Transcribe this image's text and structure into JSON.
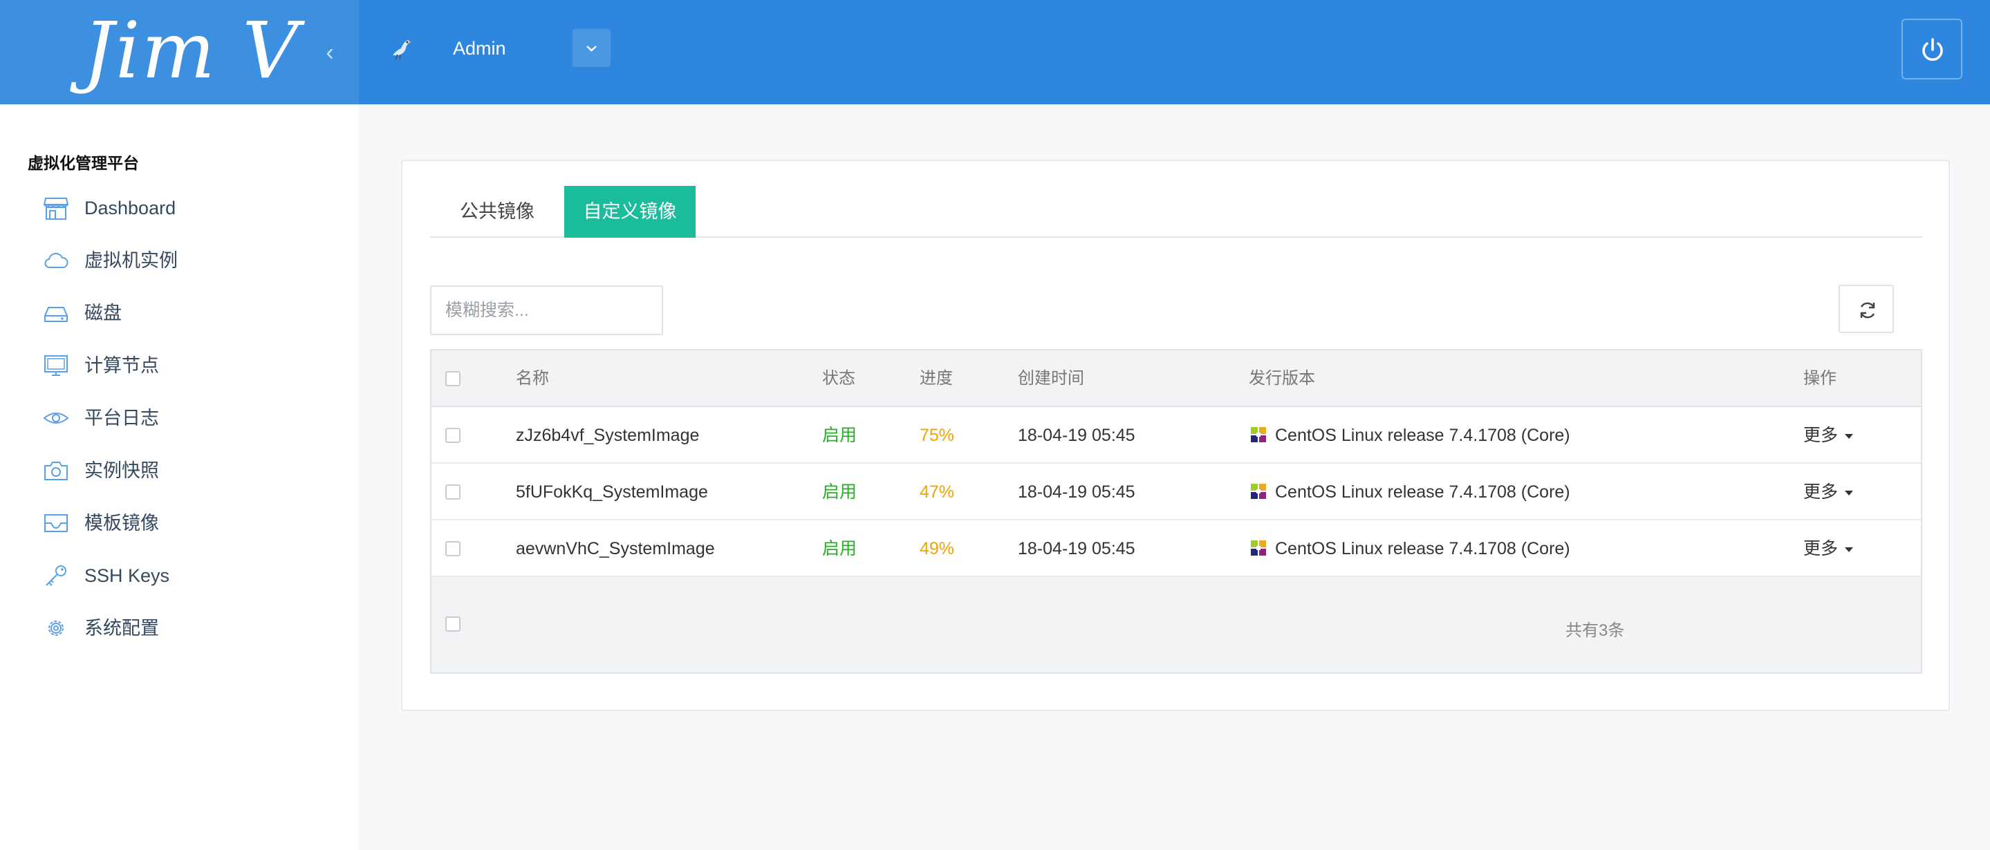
{
  "header": {
    "logo": "Jim V",
    "user_name": "Admin"
  },
  "sidebar": {
    "title": "虚拟化管理平台",
    "items": [
      {
        "label": "Dashboard",
        "icon": "store-icon"
      },
      {
        "label": "虚拟机实例",
        "icon": "cloud-icon"
      },
      {
        "label": "磁盘",
        "icon": "disk-icon"
      },
      {
        "label": "计算节点",
        "icon": "monitor-icon"
      },
      {
        "label": "平台日志",
        "icon": "eye-icon"
      },
      {
        "label": "实例快照",
        "icon": "camera-icon"
      },
      {
        "label": "模板镜像",
        "icon": "inbox-icon"
      },
      {
        "label": "SSH Keys",
        "icon": "key-icon"
      },
      {
        "label": "系统配置",
        "icon": "gear-icon"
      }
    ]
  },
  "tabs": {
    "public": "公共镜像",
    "custom": "自定义镜像",
    "active": "custom"
  },
  "search": {
    "placeholder": "模糊搜索...",
    "value": ""
  },
  "table": {
    "columns": [
      "名称",
      "状态",
      "进度",
      "创建时间",
      "发行版本",
      "操作"
    ],
    "rows": [
      {
        "name": "zJz6b4vf_SystemImage",
        "status": "启用",
        "progress": "75%",
        "created": "18-04-19 05:45",
        "os": "CentOS Linux release 7.4.1708 (Core)",
        "action": "更多"
      },
      {
        "name": "5fUFokKq_SystemImage",
        "status": "启用",
        "progress": "47%",
        "created": "18-04-19 05:45",
        "os": "CentOS Linux release 7.4.1708 (Core)",
        "action": "更多"
      },
      {
        "name": "aevwnVhC_SystemImage",
        "status": "启用",
        "progress": "49%",
        "created": "18-04-19 05:45",
        "os": "CentOS Linux release 7.4.1708 (Core)",
        "action": "更多"
      }
    ],
    "total": "共有3条"
  },
  "colors": {
    "topbar": "#2e86de",
    "brand": "#3d8fe0",
    "active_tab": "#1abc9c",
    "status_enabled": "#27ae27",
    "progress": "#f0a500"
  }
}
